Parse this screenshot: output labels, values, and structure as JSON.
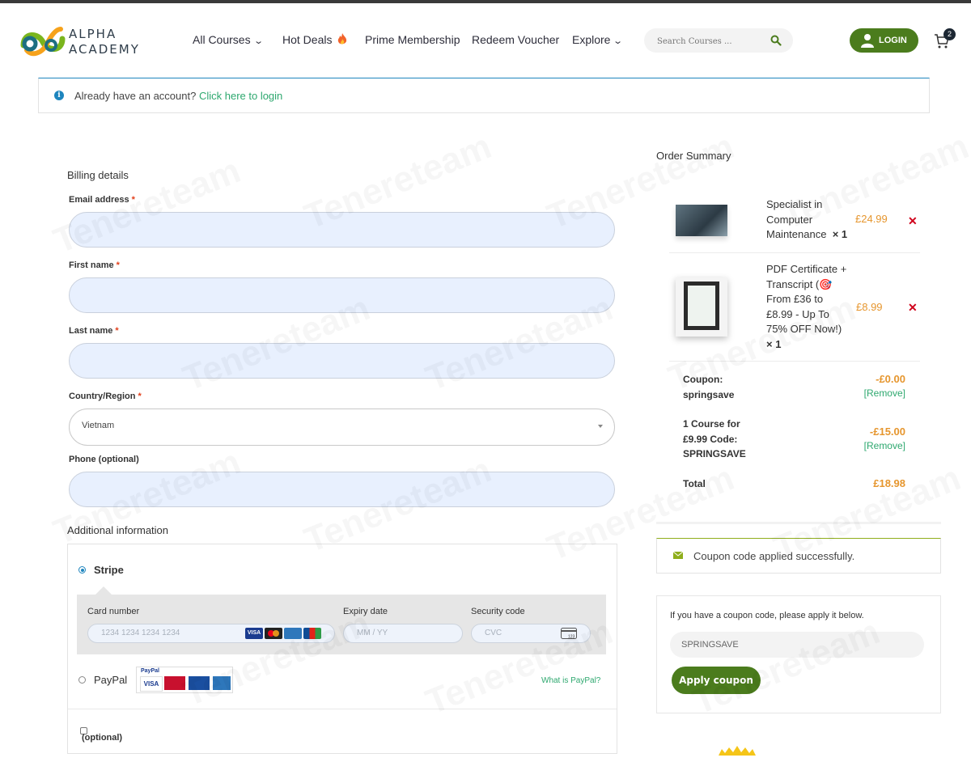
{
  "brand": {
    "name_line1": "ALPHA",
    "name_line2": "ACADEMY"
  },
  "nav": {
    "all_courses": "All Courses",
    "hot_deals": "Hot Deals",
    "prime_membership": "Prime Membership",
    "redeem_voucher": "Redeem Voucher",
    "explore": "Explore"
  },
  "search": {
    "placeholder": "Search Courses ..."
  },
  "header": {
    "login_label": "LOGIN",
    "cart_count": "2"
  },
  "login_notice": {
    "text": "Already have an account?",
    "link": "Click here to login"
  },
  "billing": {
    "title": "Billing details",
    "email_label": "Email address",
    "first_name_label": "First name",
    "last_name_label": "Last name",
    "country_label": "Country/Region",
    "country_value": "Vietnam",
    "phone_label": "Phone (optional)",
    "required_mark": "*"
  },
  "additional": {
    "title": "Additional information"
  },
  "payment": {
    "stripe_label": "Stripe",
    "card_number_label": "Card number",
    "card_number_placeholder": "1234 1234 1234 1234",
    "expiry_label": "Expiry date",
    "expiry_placeholder": "MM / YY",
    "security_label": "Security code",
    "security_placeholder": "CVC",
    "paypal_label": "PayPal",
    "paypal_link": "What is PayPal?",
    "optional_label": "(optional)",
    "paypal_logo_text": "PayPal"
  },
  "order_summary": {
    "title": "Order Summary",
    "items": [
      {
        "name_lines": [
          "Specialist in",
          "Computer",
          "Maintenance"
        ],
        "qty": "× 1",
        "price": "£24.99"
      },
      {
        "name_lines": [
          "PDF Certificate +",
          "Transcript (🎯",
          "From £36 to",
          "£8.99 - Up To",
          "75% OFF Now!)"
        ],
        "qty": "× 1",
        "price": "£8.99"
      }
    ],
    "remove_symbol": "✕",
    "coupon": {
      "label_line1": "Coupon:",
      "label_line2": "springsave",
      "value": "-£0.00",
      "remove": "[Remove]"
    },
    "deal": {
      "label_lines": [
        "1 Course for",
        "£9.99 Code:",
        "SPRINGSAVE"
      ],
      "value": "-£15.00",
      "remove": "[Remove]"
    },
    "total": {
      "label": "Total",
      "value": "£18.98"
    }
  },
  "coupon_success": {
    "text": "Coupon code applied successfully."
  },
  "coupon_form": {
    "hint": "If you have a coupon code, please apply it below.",
    "value": "SPRINGSAVE",
    "apply_label": "Apply coupon"
  },
  "watermark": "Tenereteam",
  "colors": {
    "primary_green": "#4b7c1d",
    "price_orange": "#e6962e",
    "link_green": "#2ea86f",
    "info_blue": "#1e85be",
    "remove_red": "#d0021b"
  }
}
